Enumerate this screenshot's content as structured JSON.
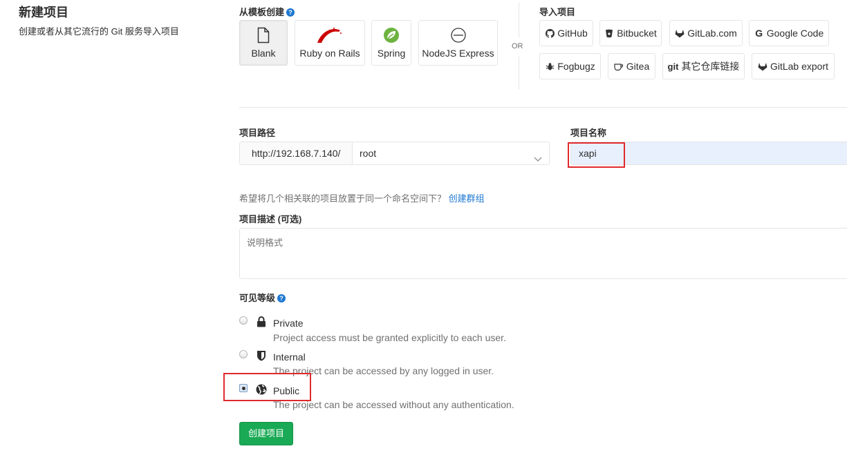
{
  "page": {
    "title": "新建项目",
    "subtitle": "创建或者从其它流行的 Git 服务导入项目"
  },
  "templates": {
    "label": "从模板创建",
    "items": [
      {
        "label": "Blank",
        "icon": "blank-file-icon",
        "selected": true
      },
      {
        "label": "Ruby on Rails",
        "icon": "rails-icon"
      },
      {
        "label": "Spring",
        "icon": "spring-leaf-icon"
      },
      {
        "label": "NodeJS Express",
        "icon": "express-icon"
      }
    ]
  },
  "or_label": "OR",
  "import": {
    "label": "导入项目",
    "items": [
      {
        "label": "GitHub",
        "icon": "github-icon"
      },
      {
        "label": "Bitbucket",
        "icon": "bitbucket-icon"
      },
      {
        "label": "GitLab.com",
        "icon": "gitlab-icon"
      },
      {
        "label": "Google Code",
        "icon": "google-icon"
      },
      {
        "label": "Fogbugz",
        "icon": "bug-icon"
      },
      {
        "label": "Gitea",
        "icon": "gitea-icon"
      },
      {
        "label": "其它仓库链接",
        "icon": "git-icon",
        "icon_text": "git"
      },
      {
        "label": "GitLab export",
        "icon": "gitlab-icon"
      }
    ]
  },
  "form": {
    "path_label": "项目路径",
    "path_prefix": "http://192.168.7.140/",
    "namespace_value": "root",
    "name_label": "项目名称",
    "name_value": "xapi",
    "hint_text": "希望将几个相关联的项目放置于同一个命名空间下？",
    "hint_link": "创建群组",
    "description_label": "项目描述 (可选)",
    "description_placeholder": "说明格式",
    "visibility_label": "可见等级",
    "visibility_options": [
      {
        "title": "Private",
        "description": "Project access must be granted explicitly to each user.",
        "icon": "lock-icon",
        "checked": false
      },
      {
        "title": "Internal",
        "description": "The project can be accessed by any logged in user.",
        "icon": "shield-icon",
        "checked": false
      },
      {
        "title": "Public",
        "description": "The project can be accessed without any authentication.",
        "icon": "globe-icon",
        "checked": true
      }
    ],
    "submit_label": "创建项目"
  },
  "colors": {
    "primary_button": "#1aaa55",
    "link": "#1f78d1",
    "highlight_box": "#e0292b",
    "autofill_bg": "#e8f0fe"
  }
}
